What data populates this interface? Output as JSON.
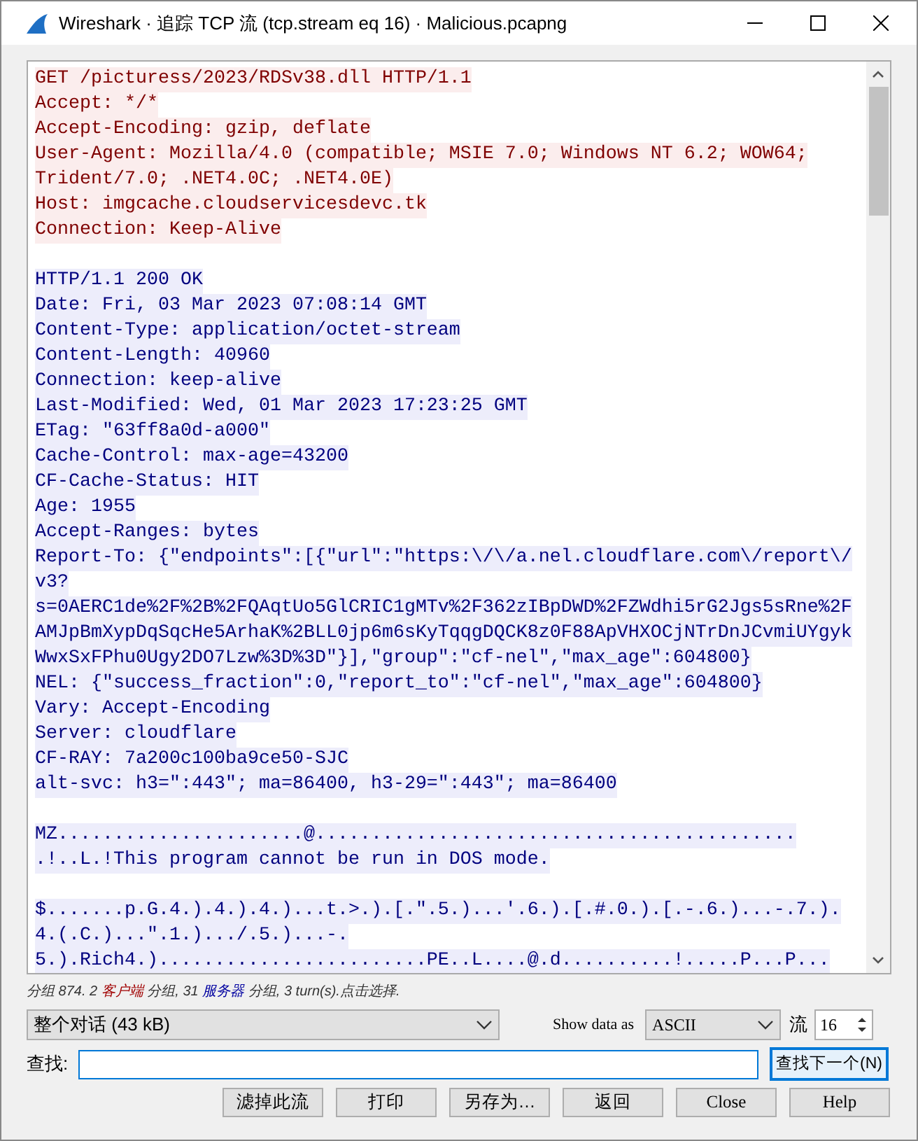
{
  "window": {
    "title": "Wireshark · 追踪 TCP 流 (tcp.stream eq 16) · Malicious.pcapng"
  },
  "stream_lines": [
    {
      "kind": "client",
      "text": "GET /picturess/2023/RDSv38.dll HTTP/1.1"
    },
    {
      "kind": "client",
      "text": "Accept: */*"
    },
    {
      "kind": "client",
      "text": "Accept-Encoding: gzip, deflate"
    },
    {
      "kind": "client",
      "text": "User-Agent: Mozilla/4.0 (compatible; MSIE 7.0; Windows NT 6.2; WOW64;"
    },
    {
      "kind": "client",
      "text": "Trident/7.0; .NET4.0C; .NET4.0E)"
    },
    {
      "kind": "client",
      "text": "Host: imgcache.cloudservicesdevc.tk"
    },
    {
      "kind": "client",
      "text": "Connection: Keep-Alive"
    },
    {
      "kind": "blank"
    },
    {
      "kind": "server",
      "text": "HTTP/1.1 200 OK"
    },
    {
      "kind": "server",
      "text": "Date: Fri, 03 Mar 2023 07:08:14 GMT"
    },
    {
      "kind": "server",
      "text": "Content-Type: application/octet-stream"
    },
    {
      "kind": "server",
      "text": "Content-Length: 40960"
    },
    {
      "kind": "server",
      "text": "Connection: keep-alive"
    },
    {
      "kind": "server",
      "text": "Last-Modified: Wed, 01 Mar 2023 17:23:25 GMT"
    },
    {
      "kind": "server",
      "text": "ETag: \"63ff8a0d-a000\""
    },
    {
      "kind": "server",
      "text": "Cache-Control: max-age=43200"
    },
    {
      "kind": "server",
      "text": "CF-Cache-Status: HIT"
    },
    {
      "kind": "server",
      "text": "Age: 1955"
    },
    {
      "kind": "server",
      "text": "Accept-Ranges: bytes"
    },
    {
      "kind": "server",
      "text": "Report-To: {\"endpoints\":[{\"url\":\"https:\\/\\/a.nel.cloudflare.com\\/report\\/"
    },
    {
      "kind": "server",
      "text": "v3?"
    },
    {
      "kind": "server",
      "text": "s=0AERC1de%2F%2B%2FQAqtUo5GlCRIC1gMTv%2F362zIBpDWD%2FZWdhi5rG2Jgs5sRne%2F"
    },
    {
      "kind": "server",
      "text": "AMJpBmXypDqSqcHe5ArhaK%2BLL0jp6m6sKyTqqgDQCK8z0F88ApVHXOCjNTrDnJCvmiUYgyk"
    },
    {
      "kind": "server",
      "text": "WwxSxFPhu0Ugy2DO7Lzw%3D%3D\"}],\"group\":\"cf-nel\",\"max_age\":604800}"
    },
    {
      "kind": "server",
      "text": "NEL: {\"success_fraction\":0,\"report_to\":\"cf-nel\",\"max_age\":604800}"
    },
    {
      "kind": "server",
      "text": "Vary: Accept-Encoding"
    },
    {
      "kind": "server",
      "text": "Server: cloudflare"
    },
    {
      "kind": "server",
      "text": "CF-RAY: 7a200c100ba9ce50-SJC"
    },
    {
      "kind": "server",
      "text": "alt-svc: h3=\":443\"; ma=86400, h3-29=\":443\"; ma=86400"
    },
    {
      "kind": "blank"
    },
    {
      "kind": "server",
      "text": "MZ......................@..........................................."
    },
    {
      "kind": "server",
      "text": ".!..L.!This program cannot be run in DOS mode."
    },
    {
      "kind": "blank"
    },
    {
      "kind": "server",
      "text": "$.......p.G.4.).4.).4.)...t.>.).[.\".5.)...'.6.).[.#.0.).[.-.6.)...-.7.)."
    },
    {
      "kind": "server",
      "text": "4.(.C.)...\".1.).../.5.)...-."
    },
    {
      "kind": "server",
      "text": "5.).Rich4.)........................PE..L....@.d..........!.....P...P..."
    }
  ],
  "status": [
    {
      "kind": "plain",
      "text": "分组 874. 2 "
    },
    {
      "kind": "client",
      "text": "客户端"
    },
    {
      "kind": "plain",
      "text": " 分组, 31 "
    },
    {
      "kind": "server",
      "text": "服务器"
    },
    {
      "kind": "plain",
      "text": " 分组, 3 turn(s).点击选择."
    }
  ],
  "conversation_select": {
    "value": "整个对话 (43 kB)"
  },
  "show_data_label": "Show data as",
  "format_select": {
    "value": "ASCII"
  },
  "stream_label": "流",
  "stream_spin": {
    "value": "16"
  },
  "find_label": "查找:",
  "find_next_button": "查找下一个(N)",
  "buttons": [
    "滤掉此流",
    "打印",
    "另存为…",
    "返回",
    "Close",
    "Help"
  ]
}
